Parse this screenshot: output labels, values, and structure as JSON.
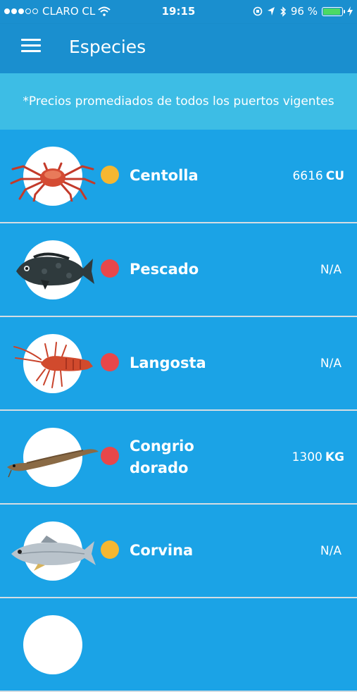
{
  "status_bar": {
    "carrier": "CLARO CL",
    "time": "19:15",
    "battery": "96 %"
  },
  "header": {
    "title": "Especies",
    "menu_icon": "hamburger-menu-icon"
  },
  "notice": "*Precios promediados de todos los puertos vigentes",
  "colors": {
    "app_bar": "#1a8fcf",
    "list_background": "#1ba3e6",
    "notice_background": "#3dbde5",
    "status_yellow": "#f5b731",
    "status_red": "#e8474a"
  },
  "species": [
    {
      "name": "Centolla",
      "value": "6616",
      "unit": "CU",
      "status": "yellow",
      "image": "crab-image"
    },
    {
      "name": "Pescado",
      "value": "N/A",
      "unit": "",
      "status": "red",
      "image": "grouper-image"
    },
    {
      "name": "Langosta",
      "value": "N/A",
      "unit": "",
      "status": "red",
      "image": "lobster-image"
    },
    {
      "name": "Congrio dorado",
      "value": "1300",
      "unit": "KG",
      "status": "red",
      "image": "eel-image"
    },
    {
      "name": "Corvina",
      "value": "N/A",
      "unit": "",
      "status": "yellow",
      "image": "croaker-image"
    }
  ]
}
